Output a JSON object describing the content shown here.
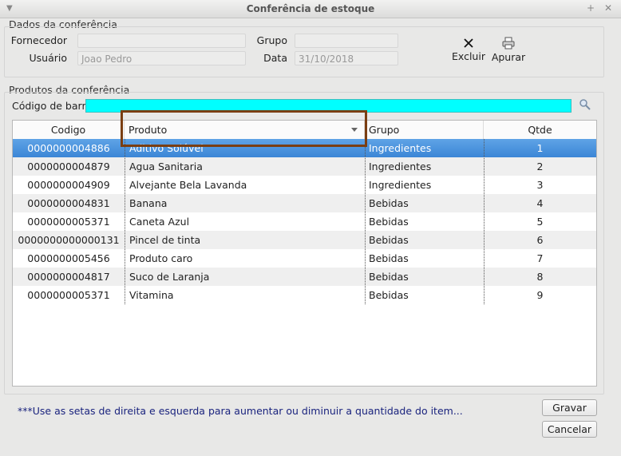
{
  "window": {
    "title": "Conferência de estoque"
  },
  "dados": {
    "section_label": "Dados da conferência",
    "fornecedor_label": "Fornecedor",
    "fornecedor_value": "",
    "grupo_label": "Grupo",
    "grupo_value": "",
    "usuario_label": "Usuário",
    "usuario_value": "Joao Pedro",
    "data_label": "Data",
    "data_value": "31/10/2018"
  },
  "toolbar": {
    "excluir_label": "Excluir",
    "apurar_label": "Apurar"
  },
  "produtos": {
    "section_label": "Produtos da conferência",
    "barcode_label": "Código de barra",
    "barcode_value": ""
  },
  "table": {
    "columns": [
      "Codigo",
      "Produto",
      "Grupo",
      "Qtde"
    ],
    "rows": [
      {
        "codigo": "0000000004886",
        "produto": "Aditivo Solúvel",
        "grupo": "Ingredientes",
        "qtde": "1"
      },
      {
        "codigo": "0000000004879",
        "produto": "Agua Sanitaria",
        "grupo": "Ingredientes",
        "qtde": "2"
      },
      {
        "codigo": "0000000004909",
        "produto": "Alvejante Bela Lavanda",
        "grupo": "Ingredientes",
        "qtde": "3"
      },
      {
        "codigo": "0000000004831",
        "produto": "Banana",
        "grupo": "Bebidas",
        "qtde": "4"
      },
      {
        "codigo": "0000000005371",
        "produto": "Caneta Azul",
        "grupo": "Bebidas",
        "qtde": "5"
      },
      {
        "codigo": "0000000000000131",
        "produto": "Pincel de tinta",
        "grupo": "Bebidas",
        "qtde": "6"
      },
      {
        "codigo": "0000000005456",
        "produto": "Produto caro",
        "grupo": "Bebidas",
        "qtde": "7"
      },
      {
        "codigo": "0000000004817",
        "produto": "Suco de Laranja",
        "grupo": "Bebidas",
        "qtde": "8"
      },
      {
        "codigo": "0000000005371",
        "produto": "Vitamina",
        "grupo": "Bebidas",
        "qtde": "9"
      }
    ],
    "selected_row": 0
  },
  "hint": "***Use as setas de direita e esquerda para aumentar ou diminuir a quantidade do item...",
  "buttons": {
    "gravar": "Gravar",
    "cancelar": "Cancelar"
  },
  "colors": {
    "barcode_bg": "#00ffff",
    "selection": "#3b86d6",
    "hint_text": "#1a237e",
    "highlight_box": "#7a3e12"
  }
}
